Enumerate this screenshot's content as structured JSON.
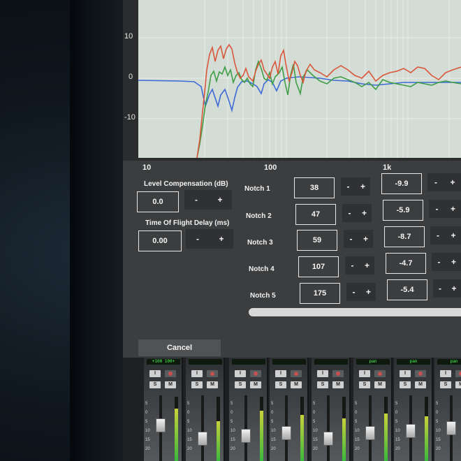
{
  "colors": {
    "curve_red": "#d9573a",
    "curve_green": "#3f9e45",
    "curve_blue": "#3d6bd6",
    "plot_bg": "#d4dcd6"
  },
  "graph": {
    "y_labels": [
      "10",
      "0",
      "-10"
    ],
    "x_labels": [
      "10",
      "100",
      "1k"
    ]
  },
  "level_compensation": {
    "label": "Level Compensation (dB)",
    "value": "0.0",
    "minus": "-",
    "plus": "+"
  },
  "time_of_flight": {
    "label": "Time Of Flight Delay (ms)",
    "value": "0.00",
    "minus": "-",
    "plus": "+"
  },
  "notches": [
    {
      "label": "Notch 1",
      "freq": "38",
      "gain": "-9.9"
    },
    {
      "label": "Notch 2",
      "freq": "47",
      "gain": "-5.9"
    },
    {
      "label": "Notch 3",
      "freq": "59",
      "gain": "-8.7"
    },
    {
      "label": "Notch 4",
      "freq": "107",
      "gain": "-4.7"
    },
    {
      "label": "Notch 5",
      "freq": "175",
      "gain": "-5.4"
    }
  ],
  "stepper": {
    "minus": "-",
    "plus": "+"
  },
  "cancel_label": "Cancel",
  "mixer": {
    "strip_buttons": {
      "input": "I",
      "solo": "S",
      "mute": "M"
    },
    "strip_lcds": [
      "+100 100+",
      "",
      "",
      "",
      "",
      "pan",
      "pan",
      "pan"
    ],
    "meter_levels": [
      0.82,
      0.62,
      0.78,
      0.72,
      0.66,
      0.74,
      0.7,
      0.64
    ],
    "fader_levels": [
      0.55,
      0.3,
      0.35,
      0.4,
      0.3,
      0.4,
      0.45,
      0.5
    ],
    "scale": [
      "5",
      "0",
      "5",
      "10",
      "15",
      "20"
    ]
  }
}
